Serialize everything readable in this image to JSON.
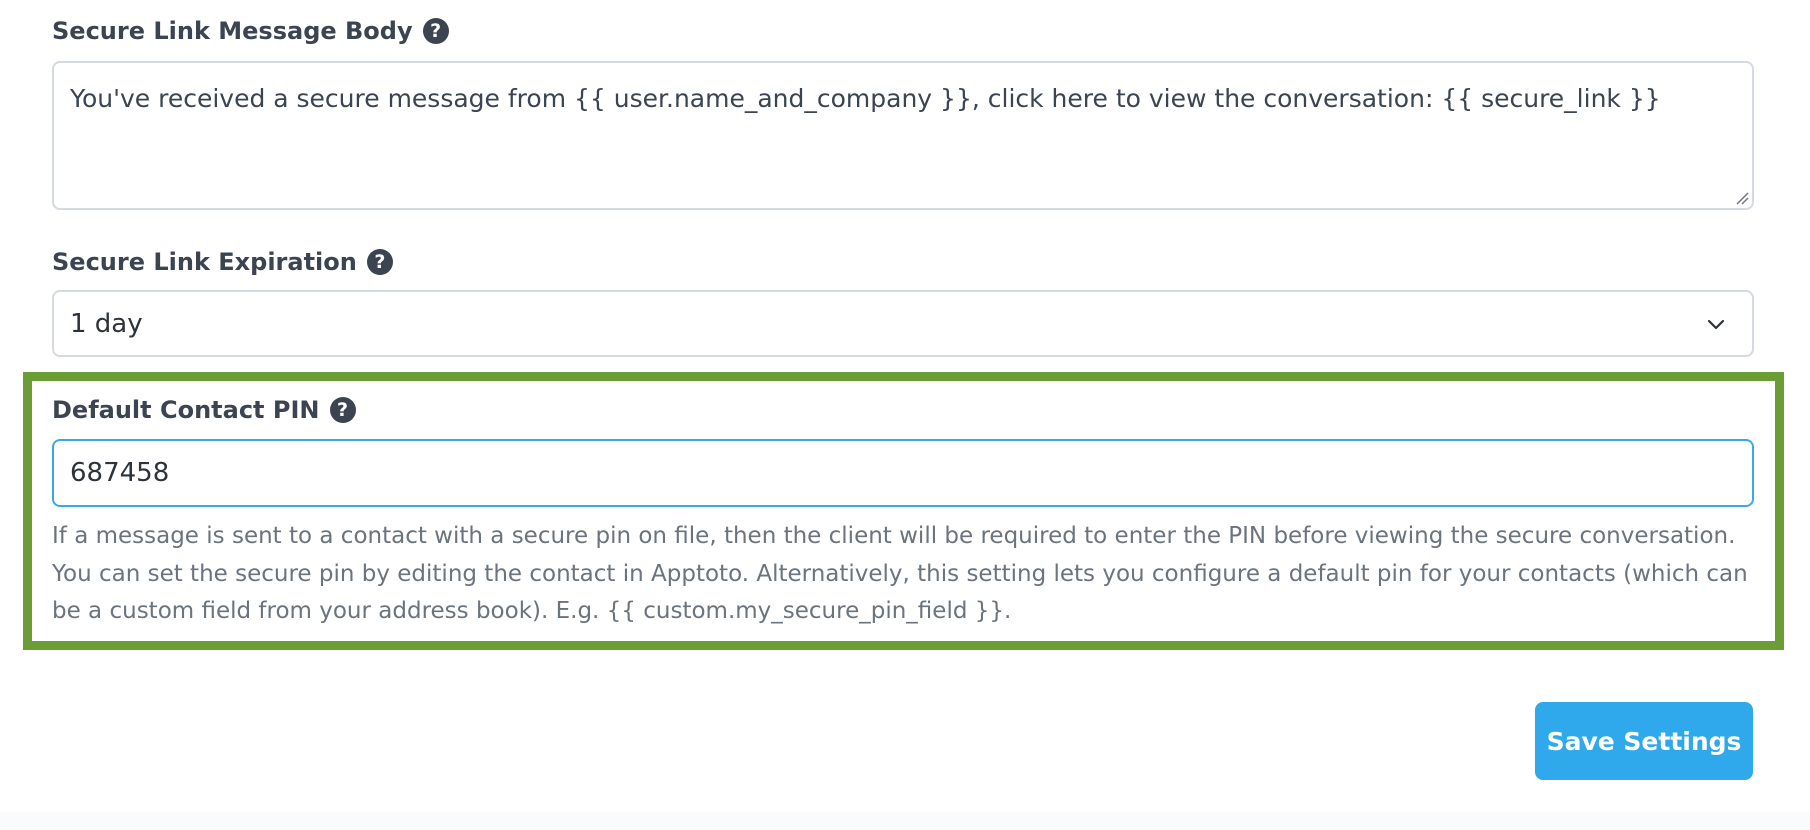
{
  "message_body": {
    "label": "Secure Link Message Body",
    "value": "You've received a secure message from {{ user.name_and_company }}, click here to view the conversation: {{ secure_link }}"
  },
  "expiration": {
    "label": "Secure Link Expiration",
    "selected": "1 day"
  },
  "pin": {
    "label": "Default Contact PIN",
    "value": "687458",
    "help_text": "If a message is sent to a contact with a secure pin on file, then the client will be required to enter the PIN before viewing the secure conversation. You can set the secure pin by editing the contact in Apptoto. Alternatively, this setting lets you configure a default pin for your contacts (which can be a custom field from your address book). E.g. {{ custom.my_secure_pin_field }}."
  },
  "help_icon_glyph": "?",
  "save_button": {
    "label": "Save Settings"
  },
  "colors": {
    "highlight_border": "#6a9e35",
    "accent": "#2fa9ec",
    "focus_border": "#3ba7e6"
  },
  "icons": {
    "help": "question-circle-icon",
    "select_arrow": "chevron-down-icon",
    "resize": "resize-grip-icon"
  }
}
